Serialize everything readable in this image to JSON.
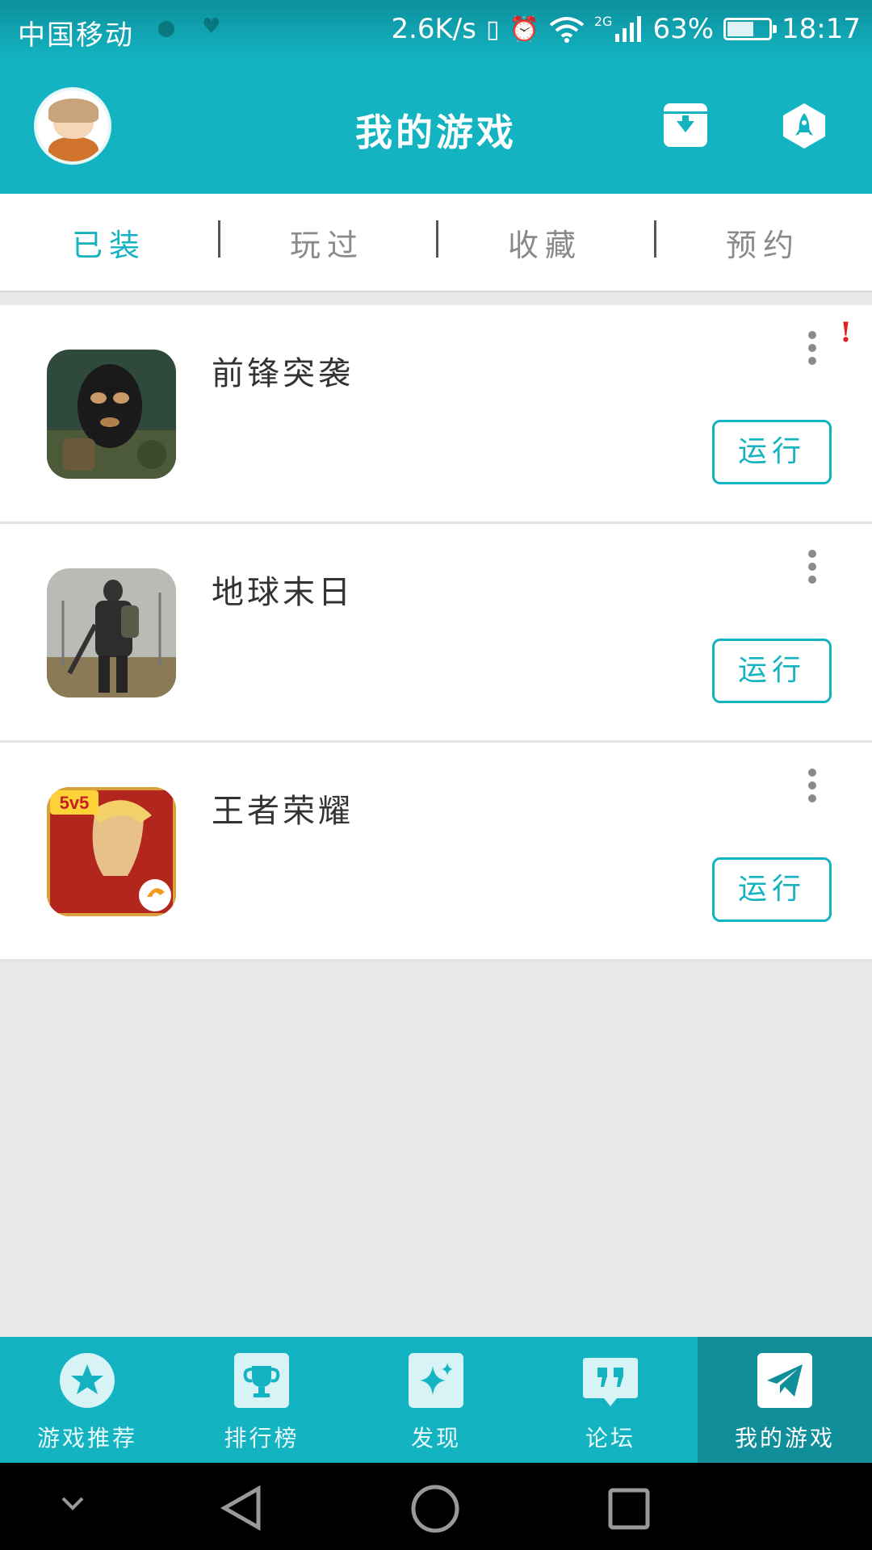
{
  "status_bar": {
    "carrier": "中国移动",
    "net_speed": "2.6K/s",
    "network_type": "2G",
    "battery": "63%",
    "battery_level": 0.63,
    "time": "18:17"
  },
  "header": {
    "title": "我的游戏",
    "avatar_icon": "user-avatar",
    "download_icon": "download-box-icon",
    "rocket_icon": "rocket-icon"
  },
  "tabs": [
    {
      "label": "已装",
      "active": true
    },
    {
      "label": "玩过",
      "active": false
    },
    {
      "label": "收藏",
      "active": false
    },
    {
      "label": "预约",
      "active": false
    }
  ],
  "games": [
    {
      "name": "前锋突袭",
      "action": "运行",
      "alert": "!"
    },
    {
      "name": "地球末日",
      "action": "运行"
    },
    {
      "name": "王者荣耀",
      "action": "运行",
      "badge": "5v5"
    }
  ],
  "bottom_nav": [
    {
      "label": "游戏推荐",
      "icon": "star-icon"
    },
    {
      "label": "排行榜",
      "icon": "trophy-icon"
    },
    {
      "label": "发现",
      "icon": "sparkle-icon"
    },
    {
      "label": "论坛",
      "icon": "quote-icon"
    },
    {
      "label": "我的游戏",
      "icon": "paper-plane-icon",
      "active": true
    }
  ],
  "colors": {
    "accent": "#14b3c1",
    "accent_dark": "#108e9a",
    "background": "#e8e8e8",
    "alert": "#e02020"
  }
}
